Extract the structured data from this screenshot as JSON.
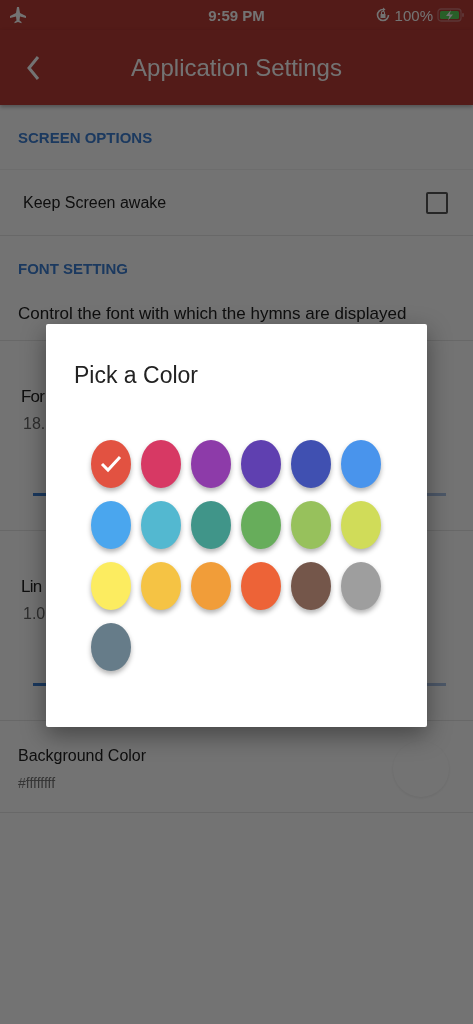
{
  "status_bar": {
    "time": "9:59 PM",
    "battery": "100%"
  },
  "header": {
    "title": "Application Settings"
  },
  "sections": [
    {
      "heading": "SCREEN OPTIONS",
      "rows": [
        {
          "kind": "checkbox",
          "label": "Keep Screen awake",
          "checked": false
        }
      ]
    },
    {
      "heading": "FONT SETTING",
      "description": "Control the font with which the hymns are displayed",
      "rows": [
        {
          "kind": "slider",
          "label": "For",
          "value": "18."
        },
        {
          "kind": "slider",
          "label": "Lin",
          "value": "1.0"
        },
        {
          "kind": "color",
          "label": "Background Color",
          "value": "#ffffffff"
        }
      ]
    }
  ],
  "dialog": {
    "title": "Pick a Color",
    "swatches": [
      {
        "color": "#e25241",
        "selected": true
      },
      {
        "color": "#d73964",
        "selected": false
      },
      {
        "color": "#8d3ba9",
        "selected": false
      },
      {
        "color": "#5f40b0",
        "selected": false
      },
      {
        "color": "#4050b1",
        "selected": false
      },
      {
        "color": "#4994ec",
        "selected": false
      },
      {
        "color": "#4aa6ee",
        "selected": false
      },
      {
        "color": "#53b8d0",
        "selected": false
      },
      {
        "color": "#409589",
        "selected": false
      },
      {
        "color": "#67ad5b",
        "selected": false
      },
      {
        "color": "#97c15c",
        "selected": false
      },
      {
        "color": "#d0dc59",
        "selected": false
      },
      {
        "color": "#fcec60",
        "selected": false
      },
      {
        "color": "#f5c344",
        "selected": false
      },
      {
        "color": "#f19d39",
        "selected": false
      },
      {
        "color": "#ed6337",
        "selected": false
      },
      {
        "color": "#74564a",
        "selected": false
      },
      {
        "color": "#9e9e9e",
        "selected": false
      },
      {
        "color": "#667c89",
        "selected": false
      }
    ]
  }
}
